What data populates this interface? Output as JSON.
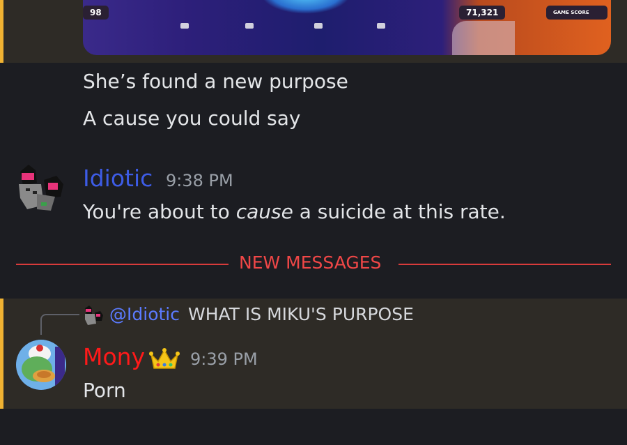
{
  "attachment": {
    "left_badge": "98",
    "score_value": "71,321",
    "score_label": "GAME SCORE"
  },
  "previous_lines": [
    "She’s found a new purpose",
    "A cause you could say"
  ],
  "message_idiotic": {
    "username": "Idiotic",
    "username_color": "#3d5ce6",
    "time": "9:38 PM",
    "text_before": "You're about to ",
    "text_emphasis": "cause",
    "text_after": " a suicide at this rate."
  },
  "divider": {
    "label": "NEW MESSAGES",
    "color": "#d83b3b"
  },
  "message_mony": {
    "reply_mention": "@Idiotic",
    "reply_text": "WHAT IS MIKU'S PURPOSE",
    "username": "Mony",
    "username_color": "#ff1a1a",
    "time": "9:39 PM",
    "text": "Porn"
  },
  "colors": {
    "background": "#1c1d22",
    "highlight": "#2e2b26",
    "accent": "#f0b232"
  }
}
